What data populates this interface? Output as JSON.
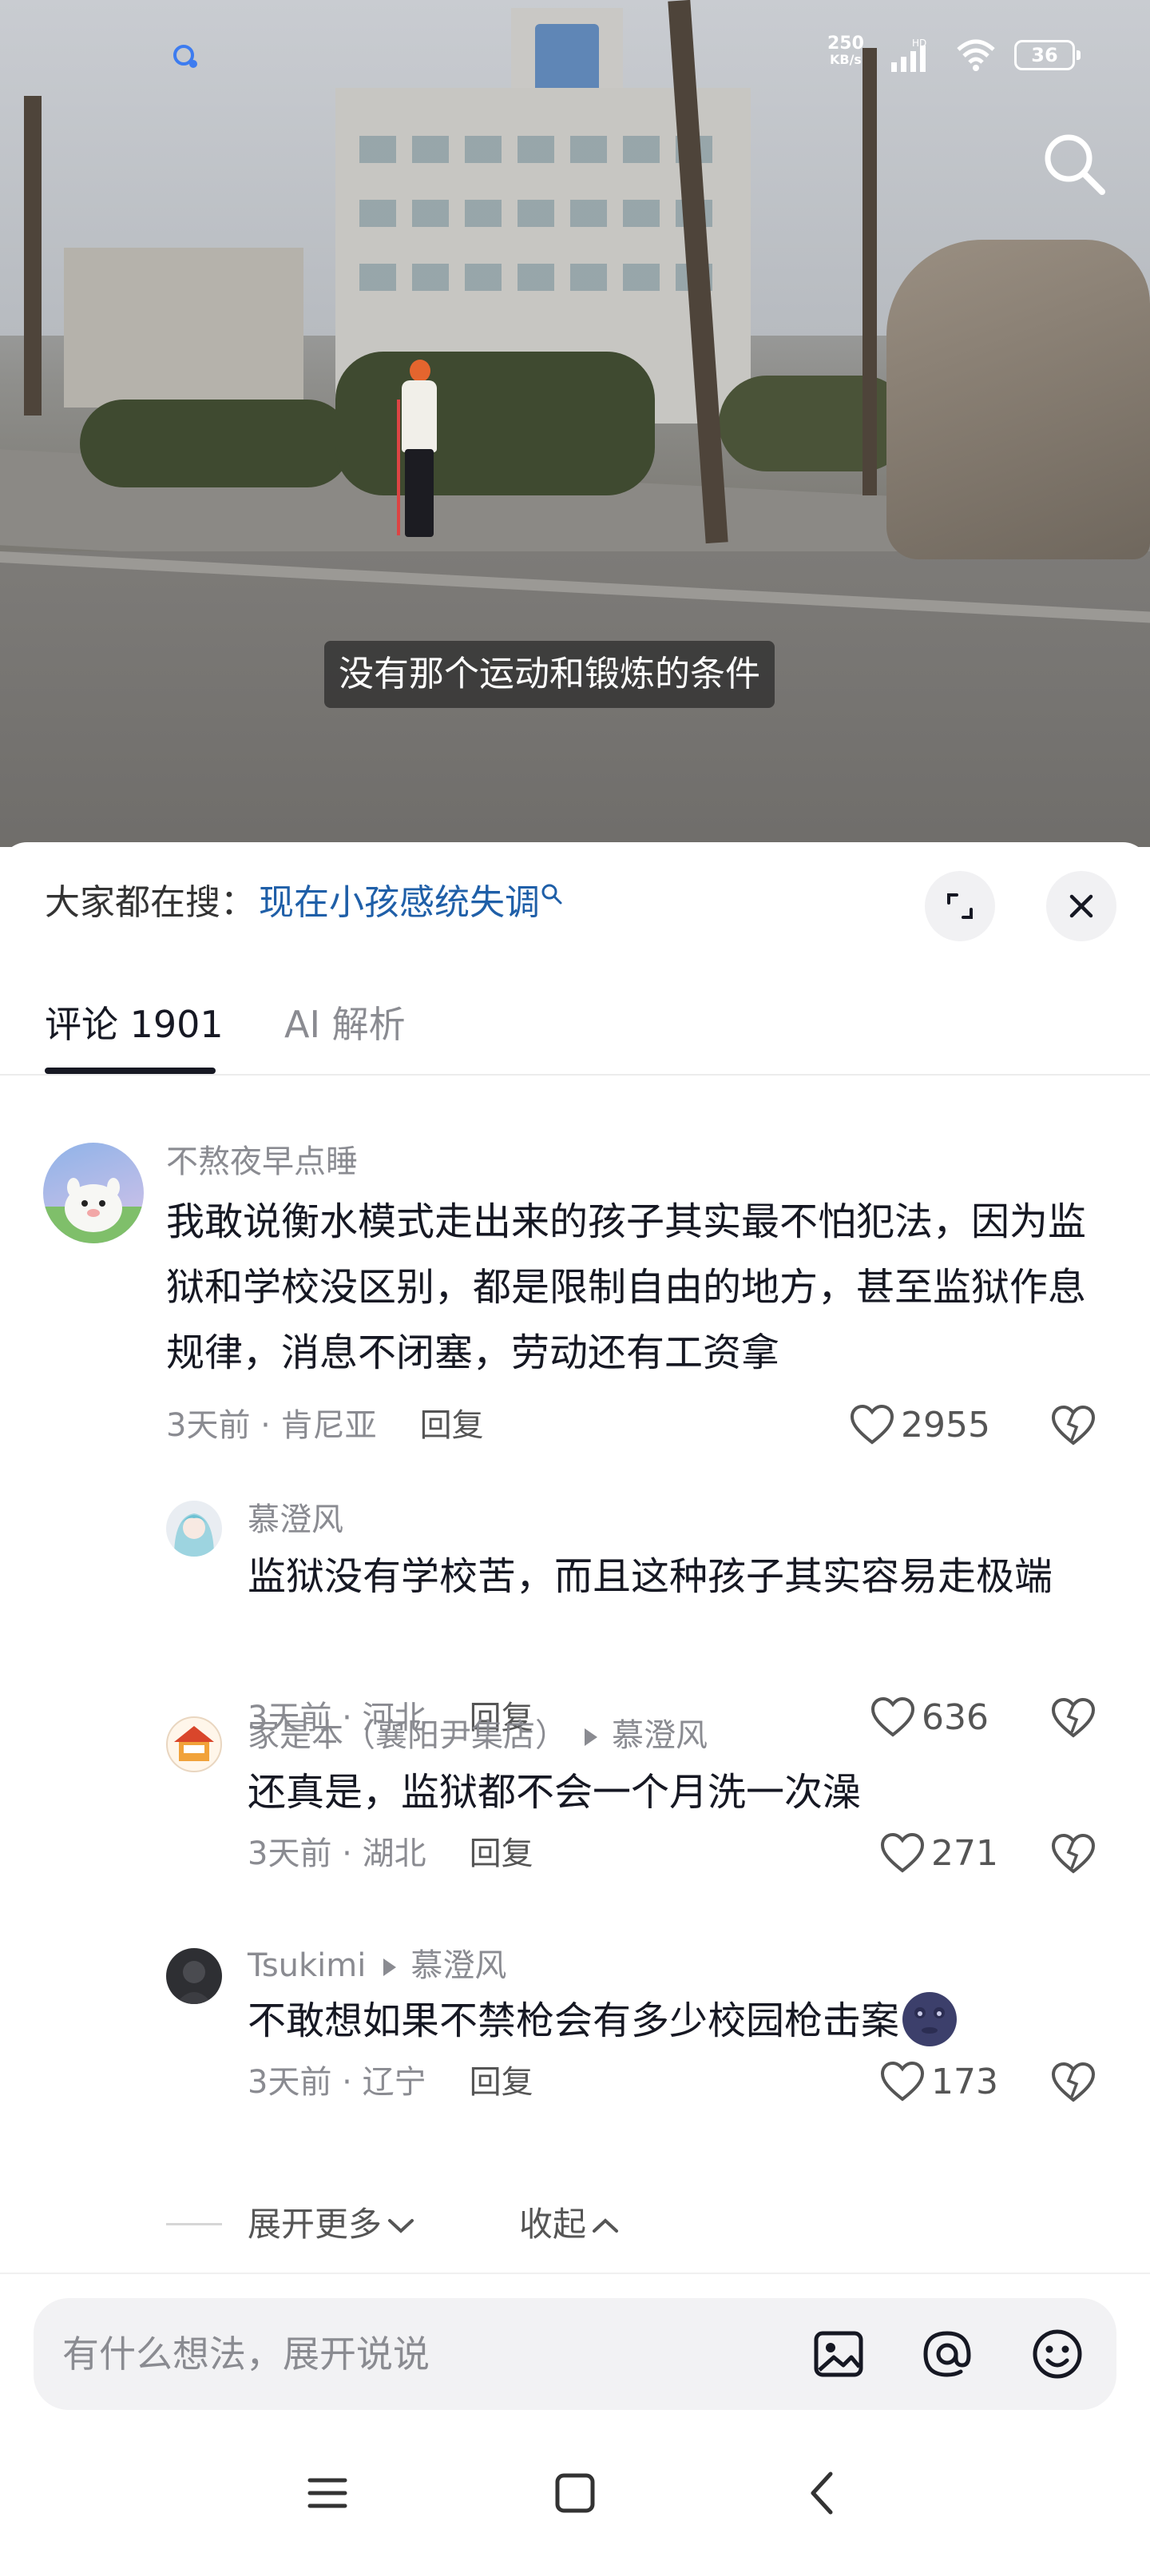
{
  "status_bar": {
    "speed_value": "250",
    "speed_unit": "KB/s",
    "network_label": "HD",
    "battery": "36"
  },
  "video": {
    "subtitle": "没有那个运动和锻炼的条件"
  },
  "hot_search": {
    "label": "大家都在搜：",
    "term": "现在小孩感统失调"
  },
  "tabs": [
    {
      "label": "评论 1901",
      "active": true
    },
    {
      "label": "AI 解析",
      "active": false
    }
  ],
  "comments": [
    {
      "username": "不熬夜早点睡",
      "text": "我敢说衡水模式走出来的孩子其实最不怕犯法，因为监狱和学校没区别，都是限制自由的地方，甚至监狱作息规律，消息不闭塞，劳动还有工资拿",
      "time_location": "3天前 · 肯尼亚",
      "reply_label": "回复",
      "likes": "2955"
    },
    {
      "username": "慕澄风",
      "text": "监狱没有学校苦，而且这种孩子其实容易走极端",
      "time_location": "3天前 · 河北",
      "reply_label": "回复",
      "likes": "636"
    },
    {
      "username": "家是本（襄阳尹集店）",
      "reply_to": "慕澄风",
      "text": "还真是，监狱都不会一个月洗一次澡",
      "time_location": "3天前 · 湖北",
      "reply_label": "回复",
      "likes": "271"
    },
    {
      "username": "Tsukimi",
      "reply_to": "慕澄风",
      "text": "不敢想如果不禁枪会有多少校园枪击案",
      "time_location": "3天前 · 辽宁",
      "reply_label": "回复",
      "likes": "173"
    }
  ],
  "thread_controls": {
    "expand_more": "展开更多",
    "collapse": "收起"
  },
  "input": {
    "placeholder": "有什么想法，展开说说"
  }
}
